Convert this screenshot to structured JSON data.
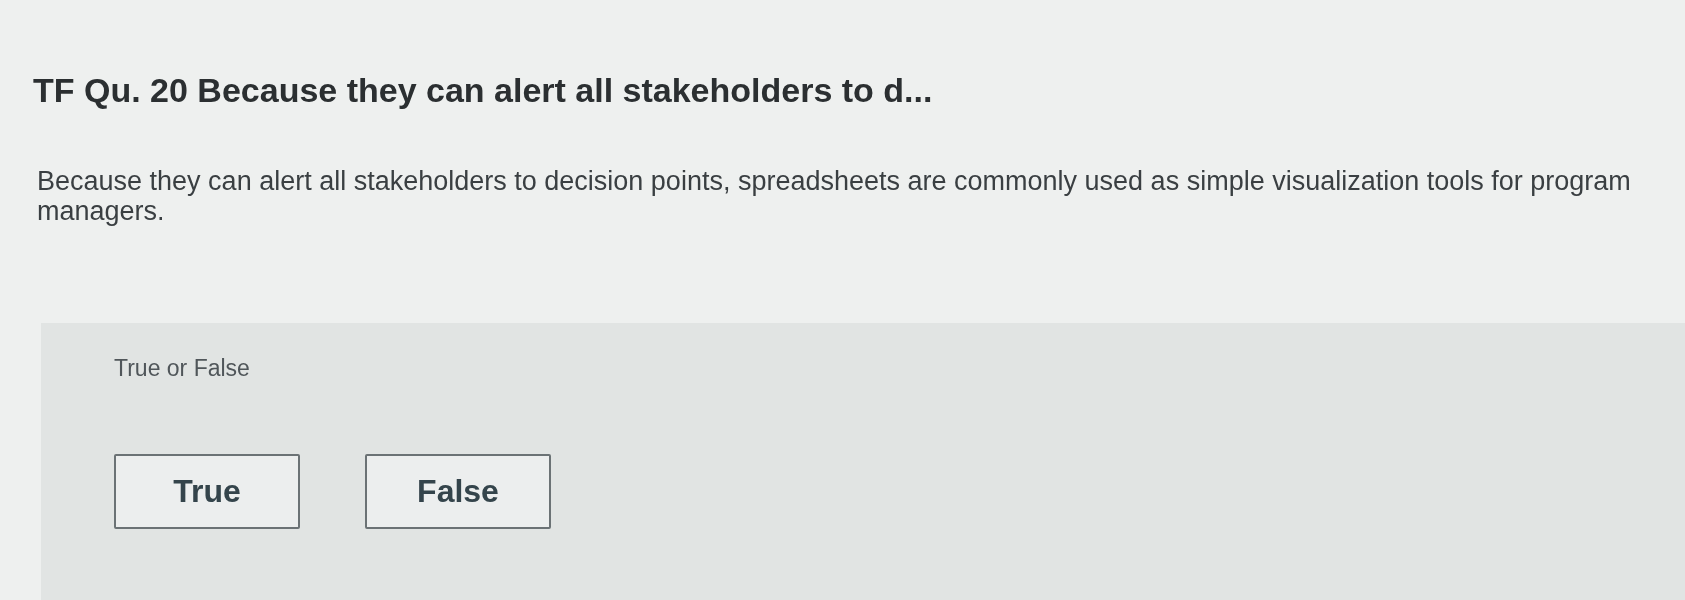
{
  "question": {
    "title": "TF Qu. 20 Because they can alert all stakeholders to d...",
    "prompt": "Because they can alert all stakeholders to decision points, spreadsheets are commonly used as simple visualization tools for program managers."
  },
  "answer_panel": {
    "label": "True or False",
    "options": [
      {
        "label": "True",
        "selected": false
      },
      {
        "label": "False",
        "selected": false
      }
    ]
  }
}
